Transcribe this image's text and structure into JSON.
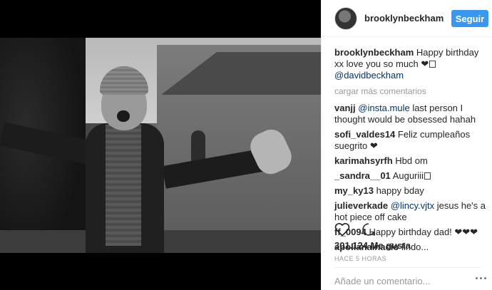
{
  "post": {
    "username": "brooklynbeckham",
    "follow_label": "Seguir",
    "caption_text": "Happy birthday xx love you so much ❤",
    "caption_mention": "@davidbeckham",
    "load_more": "cargar más comentarios",
    "likes": "301.124 Me gusta",
    "timestamp": "HACE 5 HORAS",
    "add_comment_placeholder": "Añade un comentario..."
  },
  "comments": [
    {
      "user": "vanjj",
      "mention": "@insta.mule",
      "text": " last person I thought would be obsessed hahah"
    },
    {
      "user": "sofi_valdes14",
      "mention": "",
      "text": "Feliz cumpleaños suegrito ❤"
    },
    {
      "user": "karimahsyrfh",
      "mention": "",
      "text": "Hbd om"
    },
    {
      "user": "_sandra__01",
      "mention": "",
      "text": "Auguriii"
    },
    {
      "user": "my_ky13",
      "mention": "",
      "text": "happy bday"
    },
    {
      "user": "julieverkade",
      "mention": "@lincy.vjtx",
      "text": " jesus he's a hot piece off cake"
    },
    {
      "user": "ff_0094",
      "mention": "",
      "text": "Happy birthday dad! ❤❤❤"
    },
    {
      "user": "apolianainacio",
      "mention": "",
      "text": "lindo..."
    }
  ],
  "icons": {
    "like": "heart-icon",
    "comment": "comment-icon",
    "more": "more-options-icon"
  },
  "colors": {
    "accent": "#3897f0",
    "mention": "#003569",
    "muted": "#999999"
  }
}
